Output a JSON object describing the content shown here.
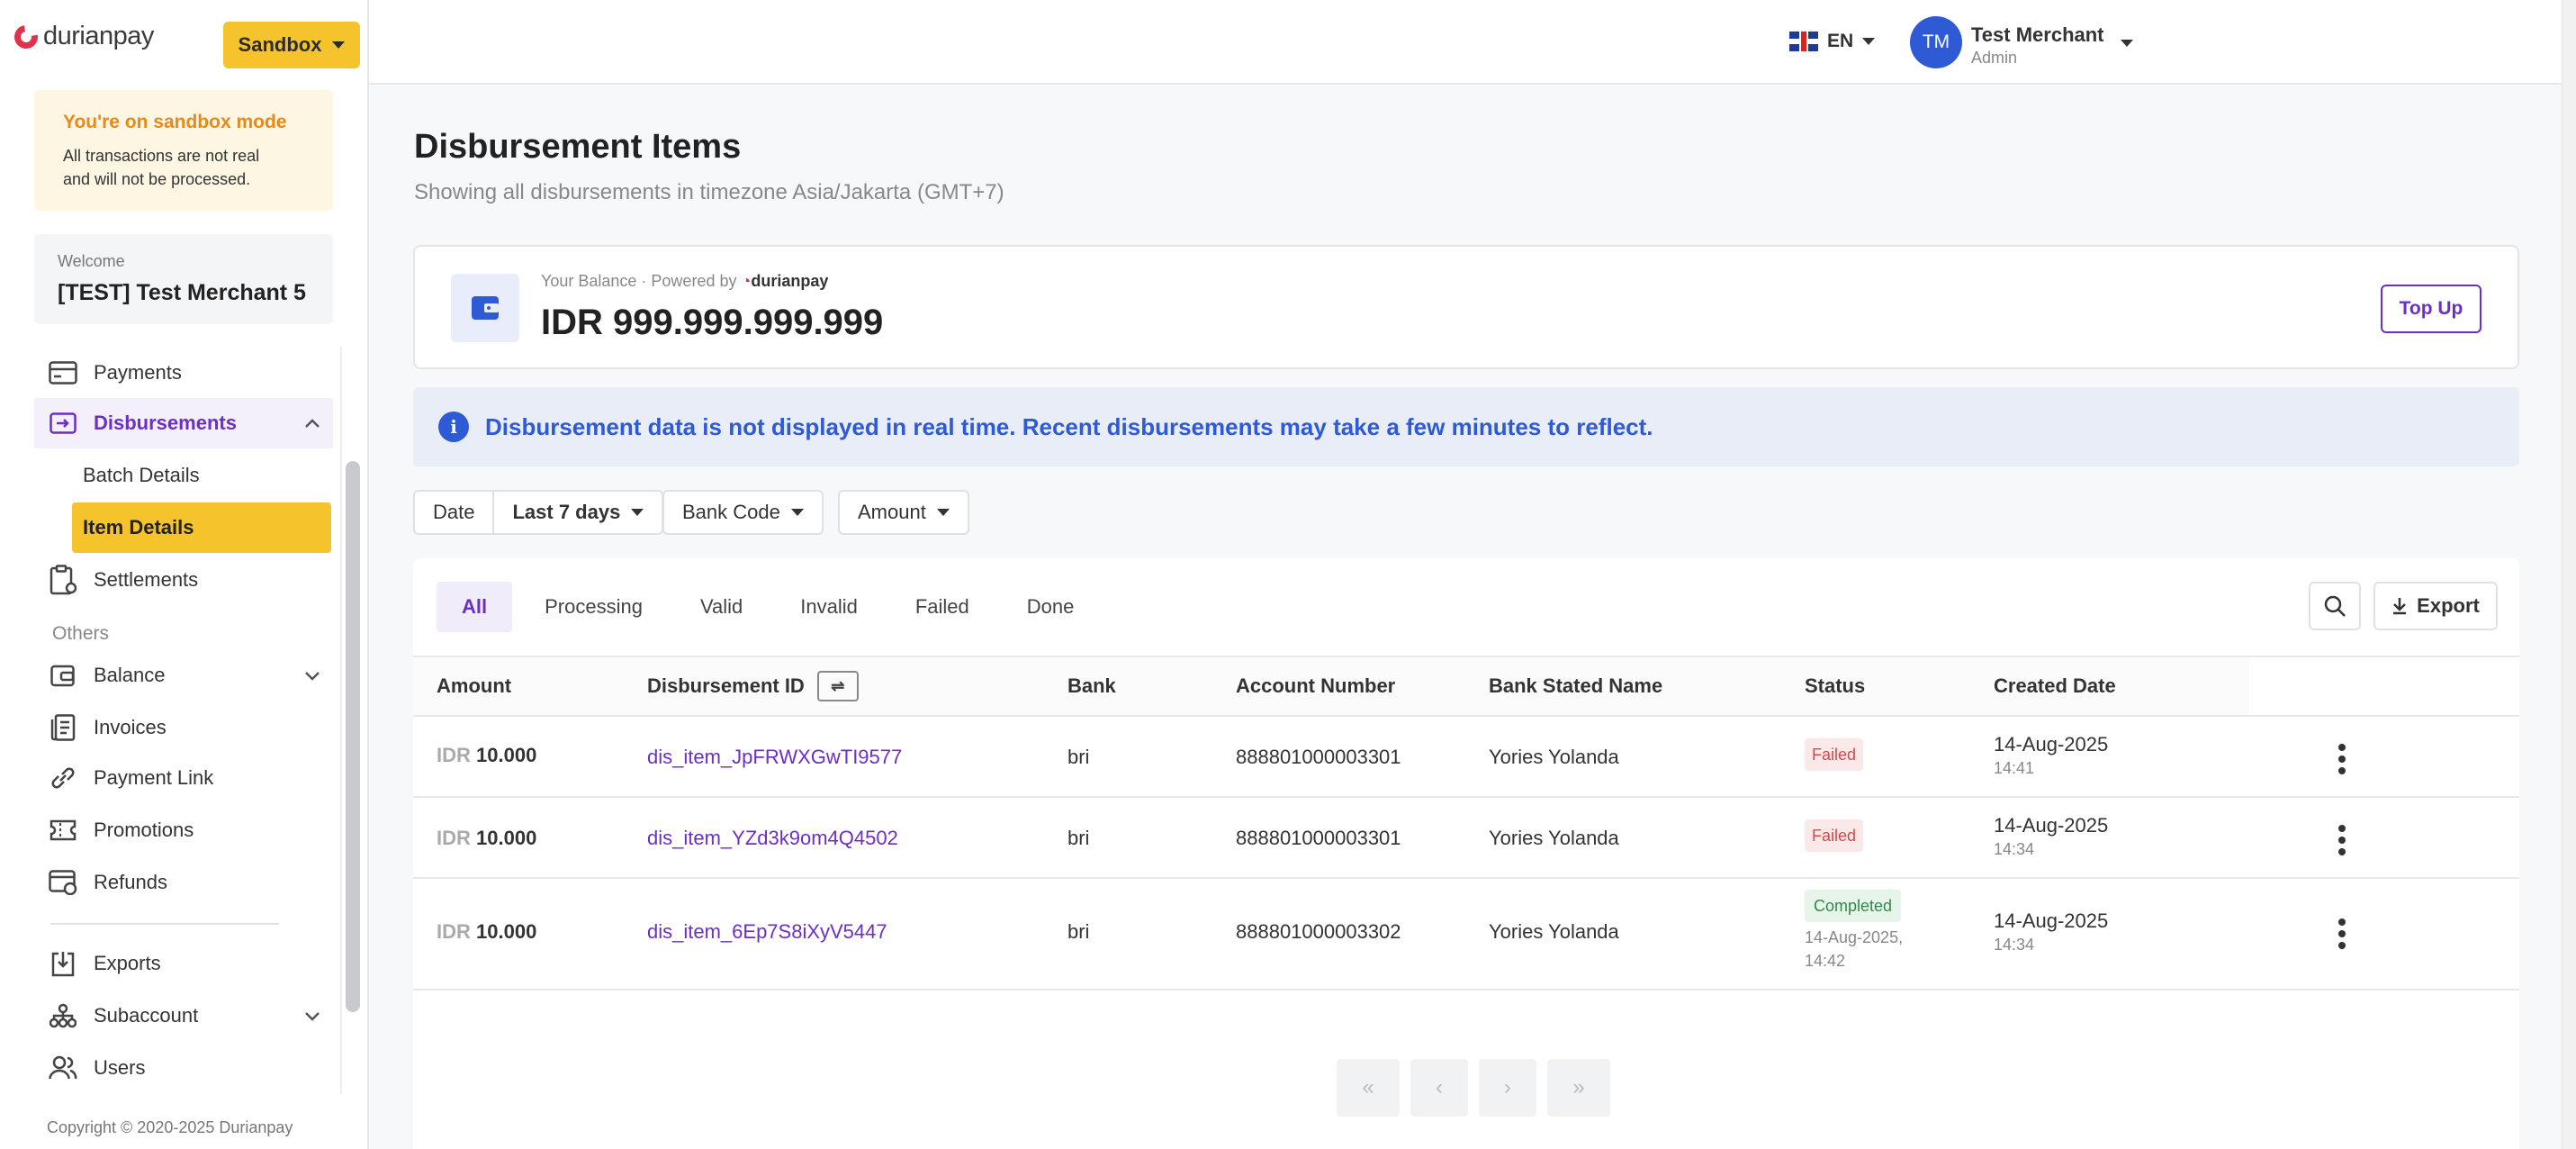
{
  "brand": {
    "name": "durianpay"
  },
  "env_button": {
    "label": "Sandbox"
  },
  "sandbox_notice": {
    "title": "You're on sandbox mode",
    "line1": "All transactions are not real",
    "line2": "and will not be processed."
  },
  "welcome": {
    "label": "Welcome",
    "merchant": "[TEST] Test Merchant 5"
  },
  "sidebar": {
    "items": [
      {
        "label": "Payments",
        "icon": "card-icon"
      },
      {
        "label": "Disbursements",
        "icon": "disbursement-icon"
      },
      {
        "label": "Settlements",
        "icon": "clipboard-icon"
      },
      {
        "label": "Balance",
        "icon": "wallet-icon"
      },
      {
        "label": "Invoices",
        "icon": "invoice-icon"
      },
      {
        "label": "Payment Link",
        "icon": "link-icon"
      },
      {
        "label": "Promotions",
        "icon": "ticket-icon"
      },
      {
        "label": "Refunds",
        "icon": "refund-icon"
      },
      {
        "label": "Exports",
        "icon": "export-icon"
      },
      {
        "label": "Subaccount",
        "icon": "hierarchy-icon"
      },
      {
        "label": "Users",
        "icon": "users-icon"
      }
    ],
    "sub_items": [
      {
        "label": "Batch Details"
      },
      {
        "label": "Item Details"
      }
    ],
    "section_others": "Others",
    "copyright": "Copyright © 2020-2025 Durianpay"
  },
  "topbar": {
    "lang": "EN",
    "avatar_initials": "TM",
    "user_name": "Test Merchant",
    "user_role": "Admin"
  },
  "page": {
    "title": "Disbursement Items",
    "subtitle": "Showing all disbursements in timezone Asia/Jakarta (GMT+7)"
  },
  "balance": {
    "label": "Your Balance · Powered by",
    "brand": "durianpay",
    "value": "IDR 999.999.999.999",
    "topup_label": "Top Up"
  },
  "info_banner": {
    "text": "Disbursement data is not displayed in real time. Recent disbursements may take a few minutes to reflect."
  },
  "filters": {
    "date_label": "Date",
    "date_value": "Last 7 days",
    "bank_code": "Bank Code",
    "amount": "Amount"
  },
  "tabs": [
    "All",
    "Processing",
    "Valid",
    "Invalid",
    "Failed",
    "Done"
  ],
  "export_label": "Export",
  "table": {
    "headers": [
      "Amount",
      "Disbursement ID",
      "Bank",
      "Account Number",
      "Bank Stated Name",
      "Status",
      "Created Date"
    ],
    "rows": [
      {
        "currency": "IDR",
        "amount": "10.000",
        "id": "dis_item_JpFRWXGwTI9577",
        "bank": "bri",
        "account": "888801000003301",
        "name": "Yories Yolanda",
        "status": "Failed",
        "status_time": "",
        "date": "14-Aug-2025",
        "time": "14:41"
      },
      {
        "currency": "IDR",
        "amount": "10.000",
        "id": "dis_item_YZd3k9om4Q4502",
        "bank": "bri",
        "account": "888801000003301",
        "name": "Yories Yolanda",
        "status": "Failed",
        "status_time": "",
        "date": "14-Aug-2025",
        "time": "14:34"
      },
      {
        "currency": "IDR",
        "amount": "10.000",
        "id": "dis_item_6Ep7S8iXyV5447",
        "bank": "bri",
        "account": "888801000003302",
        "name": "Yories Yolanda",
        "status": "Completed",
        "status_time_1": "14-Aug-2025,",
        "status_time_2": "14:42",
        "date": "14-Aug-2025",
        "time": "14:34"
      }
    ]
  },
  "pagination": {
    "first": "«",
    "prev": "‹",
    "next": "›",
    "last": "»"
  },
  "colors": {
    "accent": "#6b2fc6",
    "sandbox": "#f5c32c",
    "info": "#2f5ad6",
    "failed": "#d24b4b",
    "completed": "#2f8a4b"
  }
}
